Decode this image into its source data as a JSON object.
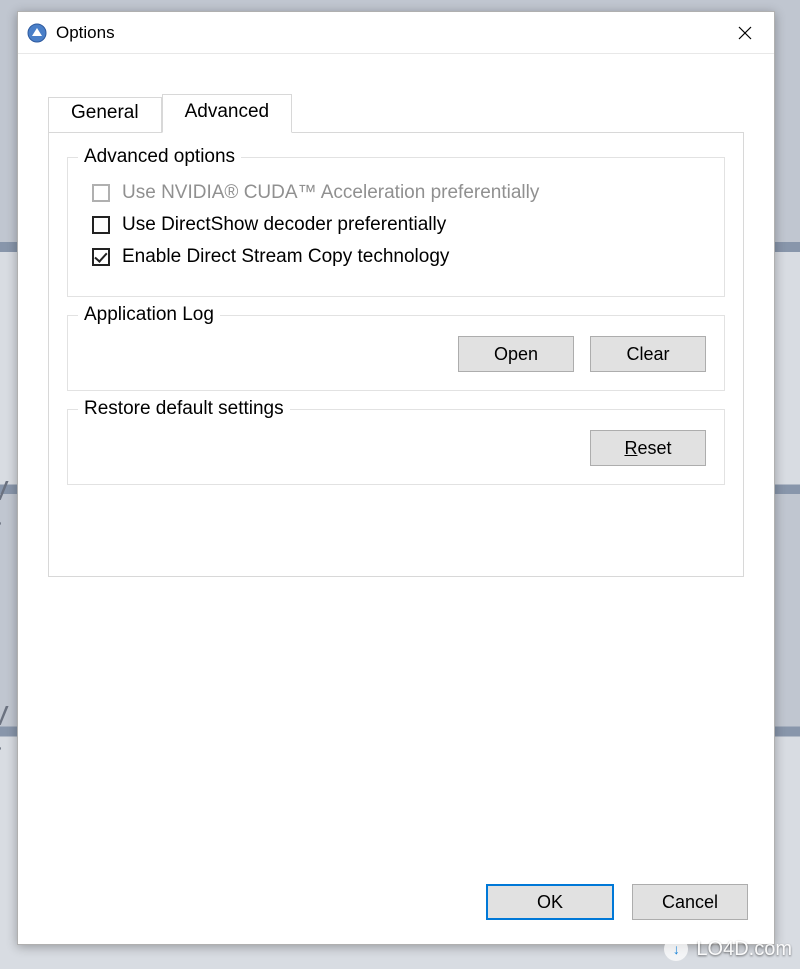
{
  "window": {
    "title": "Options",
    "icon_name": "app-icon"
  },
  "tabs": [
    {
      "label": "General",
      "active": false
    },
    {
      "label": "Advanced",
      "active": true
    }
  ],
  "groups": {
    "advanced": {
      "legend": "Advanced options",
      "options": [
        {
          "label": "Use NVIDIA® CUDA™ Acceleration preferentially",
          "checked": false,
          "disabled": true
        },
        {
          "label": "Use DirectShow decoder preferentially",
          "checked": false,
          "disabled": false
        },
        {
          "label": "Enable Direct Stream Copy technology",
          "checked": true,
          "disabled": false
        }
      ]
    },
    "log": {
      "legend": "Application Log",
      "buttons": {
        "open": "Open",
        "clear": "Clear"
      }
    },
    "restore": {
      "legend": "Restore default settings",
      "buttons": {
        "reset": "Reset"
      }
    }
  },
  "footer": {
    "ok": "OK",
    "cancel": "Cancel"
  },
  "watermark": "LO4D.com"
}
